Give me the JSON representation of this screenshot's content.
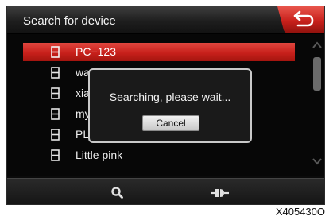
{
  "header": {
    "title": "Search for device",
    "back_icon": "back-arrow-icon"
  },
  "device_list": {
    "items": [
      {
        "label": "PC−123",
        "selected": true,
        "icon": "phone-icon"
      },
      {
        "label": "wa",
        "selected": false,
        "icon": "phone-icon"
      },
      {
        "label": "xia",
        "selected": false,
        "icon": "phone-icon"
      },
      {
        "label": "my",
        "selected": false,
        "icon": "phone-icon"
      },
      {
        "label": "PL",
        "selected": false,
        "icon": "phone-icon"
      },
      {
        "label": "Little pink",
        "selected": false,
        "icon": "phone-icon"
      }
    ]
  },
  "dialog": {
    "message": "Searching, please wait...",
    "cancel_label": "Cancel"
  },
  "bottom_bar": {
    "buttons": [
      {
        "icon": "search-icon"
      },
      {
        "icon": "connect-icon"
      }
    ]
  },
  "caption": "X405430O",
  "colors": {
    "accent": "#c8201b",
    "background": "#0b0b0b",
    "text": "#ededed"
  }
}
